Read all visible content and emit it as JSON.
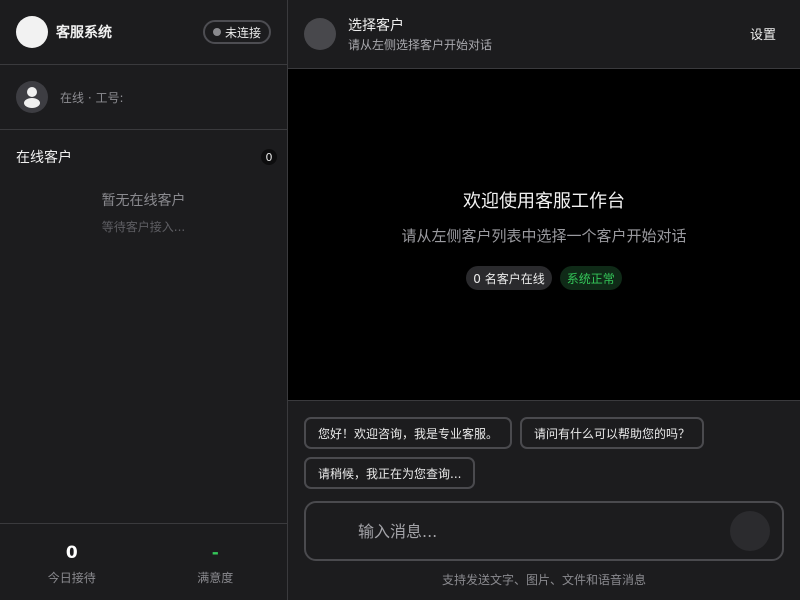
{
  "sidebar": {
    "brand": "客服系统",
    "connection_status": "未连接",
    "agent_status": "在线 · 工号:",
    "online_title": "在线客户",
    "online_count": "0",
    "empty_title": "暂无在线客户",
    "empty_sub": "等待客户接入...",
    "stats": [
      {
        "value": "0",
        "label": "今日接待"
      },
      {
        "value": "-",
        "label": "满意度"
      }
    ]
  },
  "chat_header": {
    "customer_name": "选择客户",
    "customer_hint": "请从左侧选择客户开始对话",
    "settings_label": "设置"
  },
  "welcome": {
    "title": "欢迎使用客服工作台",
    "subtitle": "请从左侧客户列表中选择一个客户开始对话",
    "online_badge": "0 名客户在线",
    "status_badge": "系统正常"
  },
  "composer": {
    "quick_replies": [
      "您好！欢迎咨询，我是专业客服。",
      "请问有什么可以帮助您的吗？",
      "请稍候，我正在为您查询..."
    ],
    "input_placeholder": "输入消息...",
    "hint": "支持发送文字、图片、文件和语音消息"
  },
  "colors": {
    "status_green": "#34c759",
    "welcome_bg": "#000000",
    "panel_bg": "#1c1c1e"
  },
  "icons": {
    "agent_avatar": "user-icon",
    "send": "send-icon"
  }
}
